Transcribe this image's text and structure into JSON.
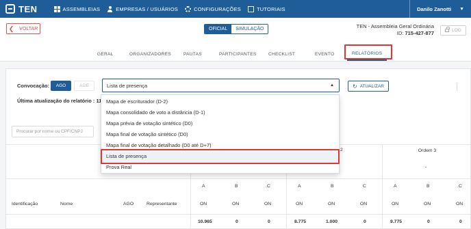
{
  "app": {
    "logo_text": "TEN"
  },
  "nav": [
    {
      "label": "ASSEMBLEIAS",
      "icon": "grid-icon"
    },
    {
      "label": "EMPRESAS / USUÁRIOS",
      "icon": "user-icon"
    },
    {
      "label": "CONFIGURAÇÕES",
      "icon": "gear-icon"
    },
    {
      "label": "TUTORIAIS",
      "icon": "external-link-icon"
    }
  ],
  "user": {
    "name": "Danilo Zanotti"
  },
  "header": {
    "back_label": "VOLTAR",
    "mode": {
      "official": "OFICIAL",
      "simulation": "SIMULAÇÃO",
      "selected": "OFICIAL"
    },
    "meeting_title": "TEN - Assembleia Geral Ordinária",
    "meeting_id_label": "ID:",
    "meeting_id": "715-427-877",
    "log_label": "LOG"
  },
  "tabs": [
    "GERAL",
    "ORGANIZADORES",
    "PAUTAS",
    "PARTICIPANTES",
    "CHECKLIST",
    "EVENTO",
    "RELATÓRIOS"
  ],
  "active_tab": "RELATÓRIOS",
  "reports": {
    "convocation_label": "Convocação:",
    "convocation_options": [
      "AGO",
      "AGE"
    ],
    "convocation_selected": "AGO",
    "report_selected": "Lista de presença",
    "update_label": "ATUALIZAR",
    "last_update_label": "Última atualização do relatório : 11,",
    "report_options": [
      "Mapa de escriturador (D-2)",
      "Mapa consolidado de voto a distância (D-1)",
      "Mapa prévia de votação sintético (D0)",
      "Mapa final de votação sintético (D0)",
      "Mapa final de votação detalhado (D0 até D+7)",
      "Lista de presença",
      "Prova Real"
    ]
  },
  "table": {
    "search_placeholder": "Procurar por nome ou CPF/CNPJ",
    "order_fragment": "2",
    "order3_label": "Ordem 3",
    "dash": "-",
    "abc": [
      "A",
      "B",
      "C",
      "A",
      "B",
      "C",
      "A",
      "B",
      "C"
    ],
    "col_headers": [
      "Identificação",
      "Nome",
      "AGO",
      "Representante"
    ],
    "on_values": [
      "ON",
      "ON",
      "ON",
      "ON",
      "ON",
      "ON",
      "ON",
      "ON",
      "ON"
    ],
    "totals": [
      "10.965",
      "0",
      "0",
      "8.775",
      "1.000",
      "0",
      "9.775",
      "0",
      "0"
    ]
  },
  "colors": {
    "primary": "#1f5d99",
    "danger": "#d9534f",
    "highlight": "#e3342f"
  }
}
